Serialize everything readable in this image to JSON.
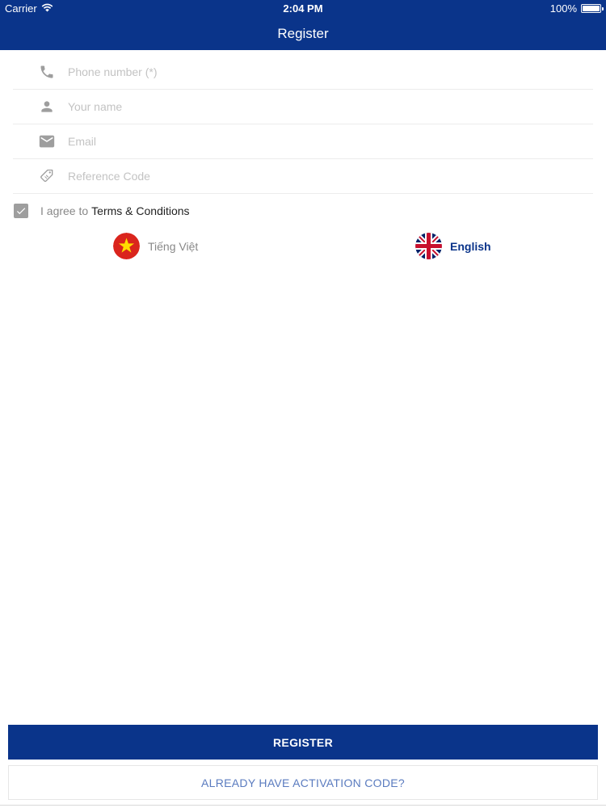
{
  "status_bar": {
    "carrier": "Carrier",
    "time": "2:04 PM",
    "battery": "100%",
    "battery_level": 1.0
  },
  "nav": {
    "title": "Register"
  },
  "form": {
    "fields": [
      {
        "placeholder": "Phone number (*)",
        "icon": "phone-icon",
        "value": ""
      },
      {
        "placeholder": "Your name",
        "icon": "person-icon",
        "value": ""
      },
      {
        "placeholder": "Email",
        "icon": "mail-icon",
        "value": ""
      },
      {
        "placeholder": "Reference Code",
        "icon": "tag-icon",
        "value": ""
      }
    ],
    "agree_prefix": "I agree to",
    "terms_label": "Terms & Conditions",
    "agree_checked": true
  },
  "languages": [
    {
      "label": "Tiếng Việt",
      "icon": "vietnam-flag-icon",
      "selected": false
    },
    {
      "label": "English",
      "icon": "uk-flag-icon",
      "selected": true
    }
  ],
  "buttons": {
    "register": "REGISTER",
    "activation": "ALREADY HAVE ACTIVATION CODE?"
  },
  "colors": {
    "primary": "#0a348a",
    "link": "#5a7bbf",
    "icon_gray": "#9e9e9e",
    "vn_red": "#da251d",
    "vn_star": "#ffde00",
    "uk_blue": "#012169",
    "uk_red": "#c8102e"
  }
}
